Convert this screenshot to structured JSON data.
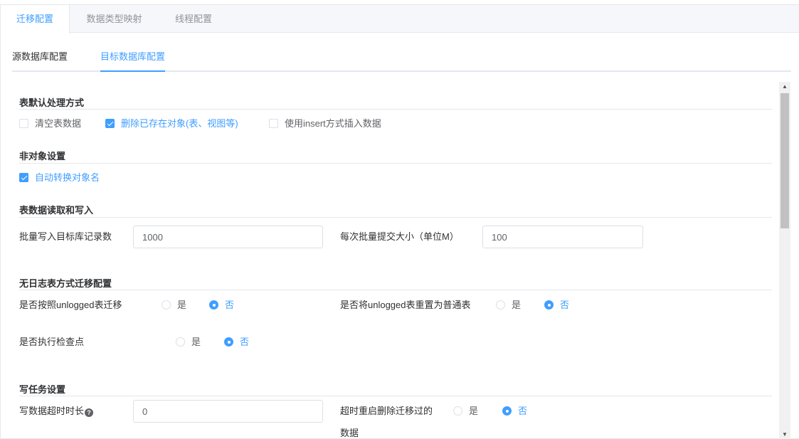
{
  "top_tabs": [
    "迁移配置",
    "数据类型映射",
    "线程配置"
  ],
  "sub_tabs": [
    "源数据库配置",
    "目标数据库配置"
  ],
  "sections": {
    "table_default": {
      "title": "表默认处理方式",
      "options": [
        {
          "label": "清空表数据",
          "checked": false
        },
        {
          "label": "删除已存在对象(表、视图等)",
          "checked": true
        },
        {
          "label": "使用insert方式插入数据",
          "checked": false
        }
      ]
    },
    "non_object": {
      "title": "非对象设置",
      "options": [
        {
          "label": "自动转换对象名",
          "checked": true
        }
      ]
    },
    "read_write": {
      "title": "表数据读取和写入",
      "batch_records_label": "批量写入目标库记录数",
      "batch_records_value": "1000",
      "batch_size_label": "每次批量提交大小（单位M）",
      "batch_size_value": "100"
    },
    "unlogged": {
      "title": "无日志表方式迁移配置",
      "q1_label": "是否按照unlogged表迁移",
      "q2_label": "是否将unlogged表重置为普通表",
      "q3_label": "是否执行检查点",
      "yes": "是",
      "no": "否"
    },
    "write_task": {
      "title": "写任务设置",
      "timeout_label": "写数据超时时长",
      "timeout_value": "0",
      "restart_label_1": "超时重启删除迁移过的",
      "restart_label_2": "数据",
      "yes": "是",
      "no": "否"
    }
  },
  "colors": {
    "accent": "#409eff",
    "border": "#e4e7ed",
    "text": "#303133"
  },
  "icons": [
    "help-icon",
    "checkmark-icon",
    "scroll-up-icon",
    "scroll-down-icon"
  ]
}
